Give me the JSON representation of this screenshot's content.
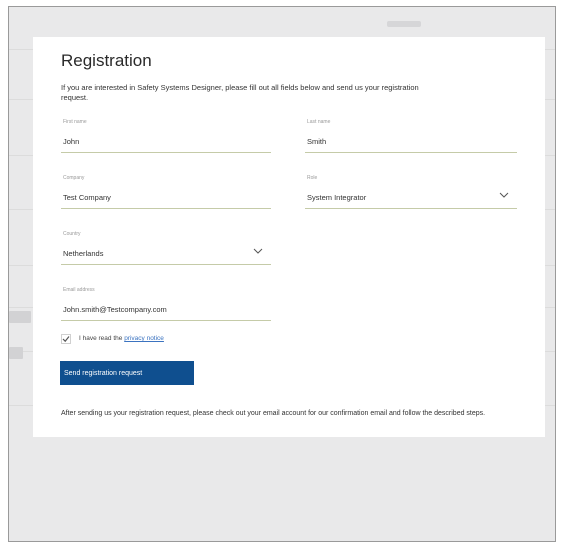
{
  "registration": {
    "title": "Registration",
    "intro": "If you are interested in Safety Systems Designer, please fill out all fields below and send us your registration request.",
    "first_name": {
      "label": "First name",
      "value": "John"
    },
    "last_name": {
      "label": "Last name",
      "value": "Smith"
    },
    "company": {
      "label": "Company",
      "value": "Test Company"
    },
    "role": {
      "label": "Role",
      "value": "System Integrator"
    },
    "country": {
      "label": "Country",
      "value": "Netherlands"
    },
    "email": {
      "label": "Email address",
      "value": "John.smith@Testcompany.com"
    },
    "privacy_prefix": "I have read the",
    "privacy_link": "privacy notice",
    "privacy_checked": true,
    "submit_label": "Send registration request",
    "after_text": "After sending us your registration request, please check out your email account for our confirmation email and follow the described steps."
  },
  "colors": {
    "button": "#0f4f8f",
    "link": "#3b73c0",
    "underline": "#c5cba8"
  }
}
